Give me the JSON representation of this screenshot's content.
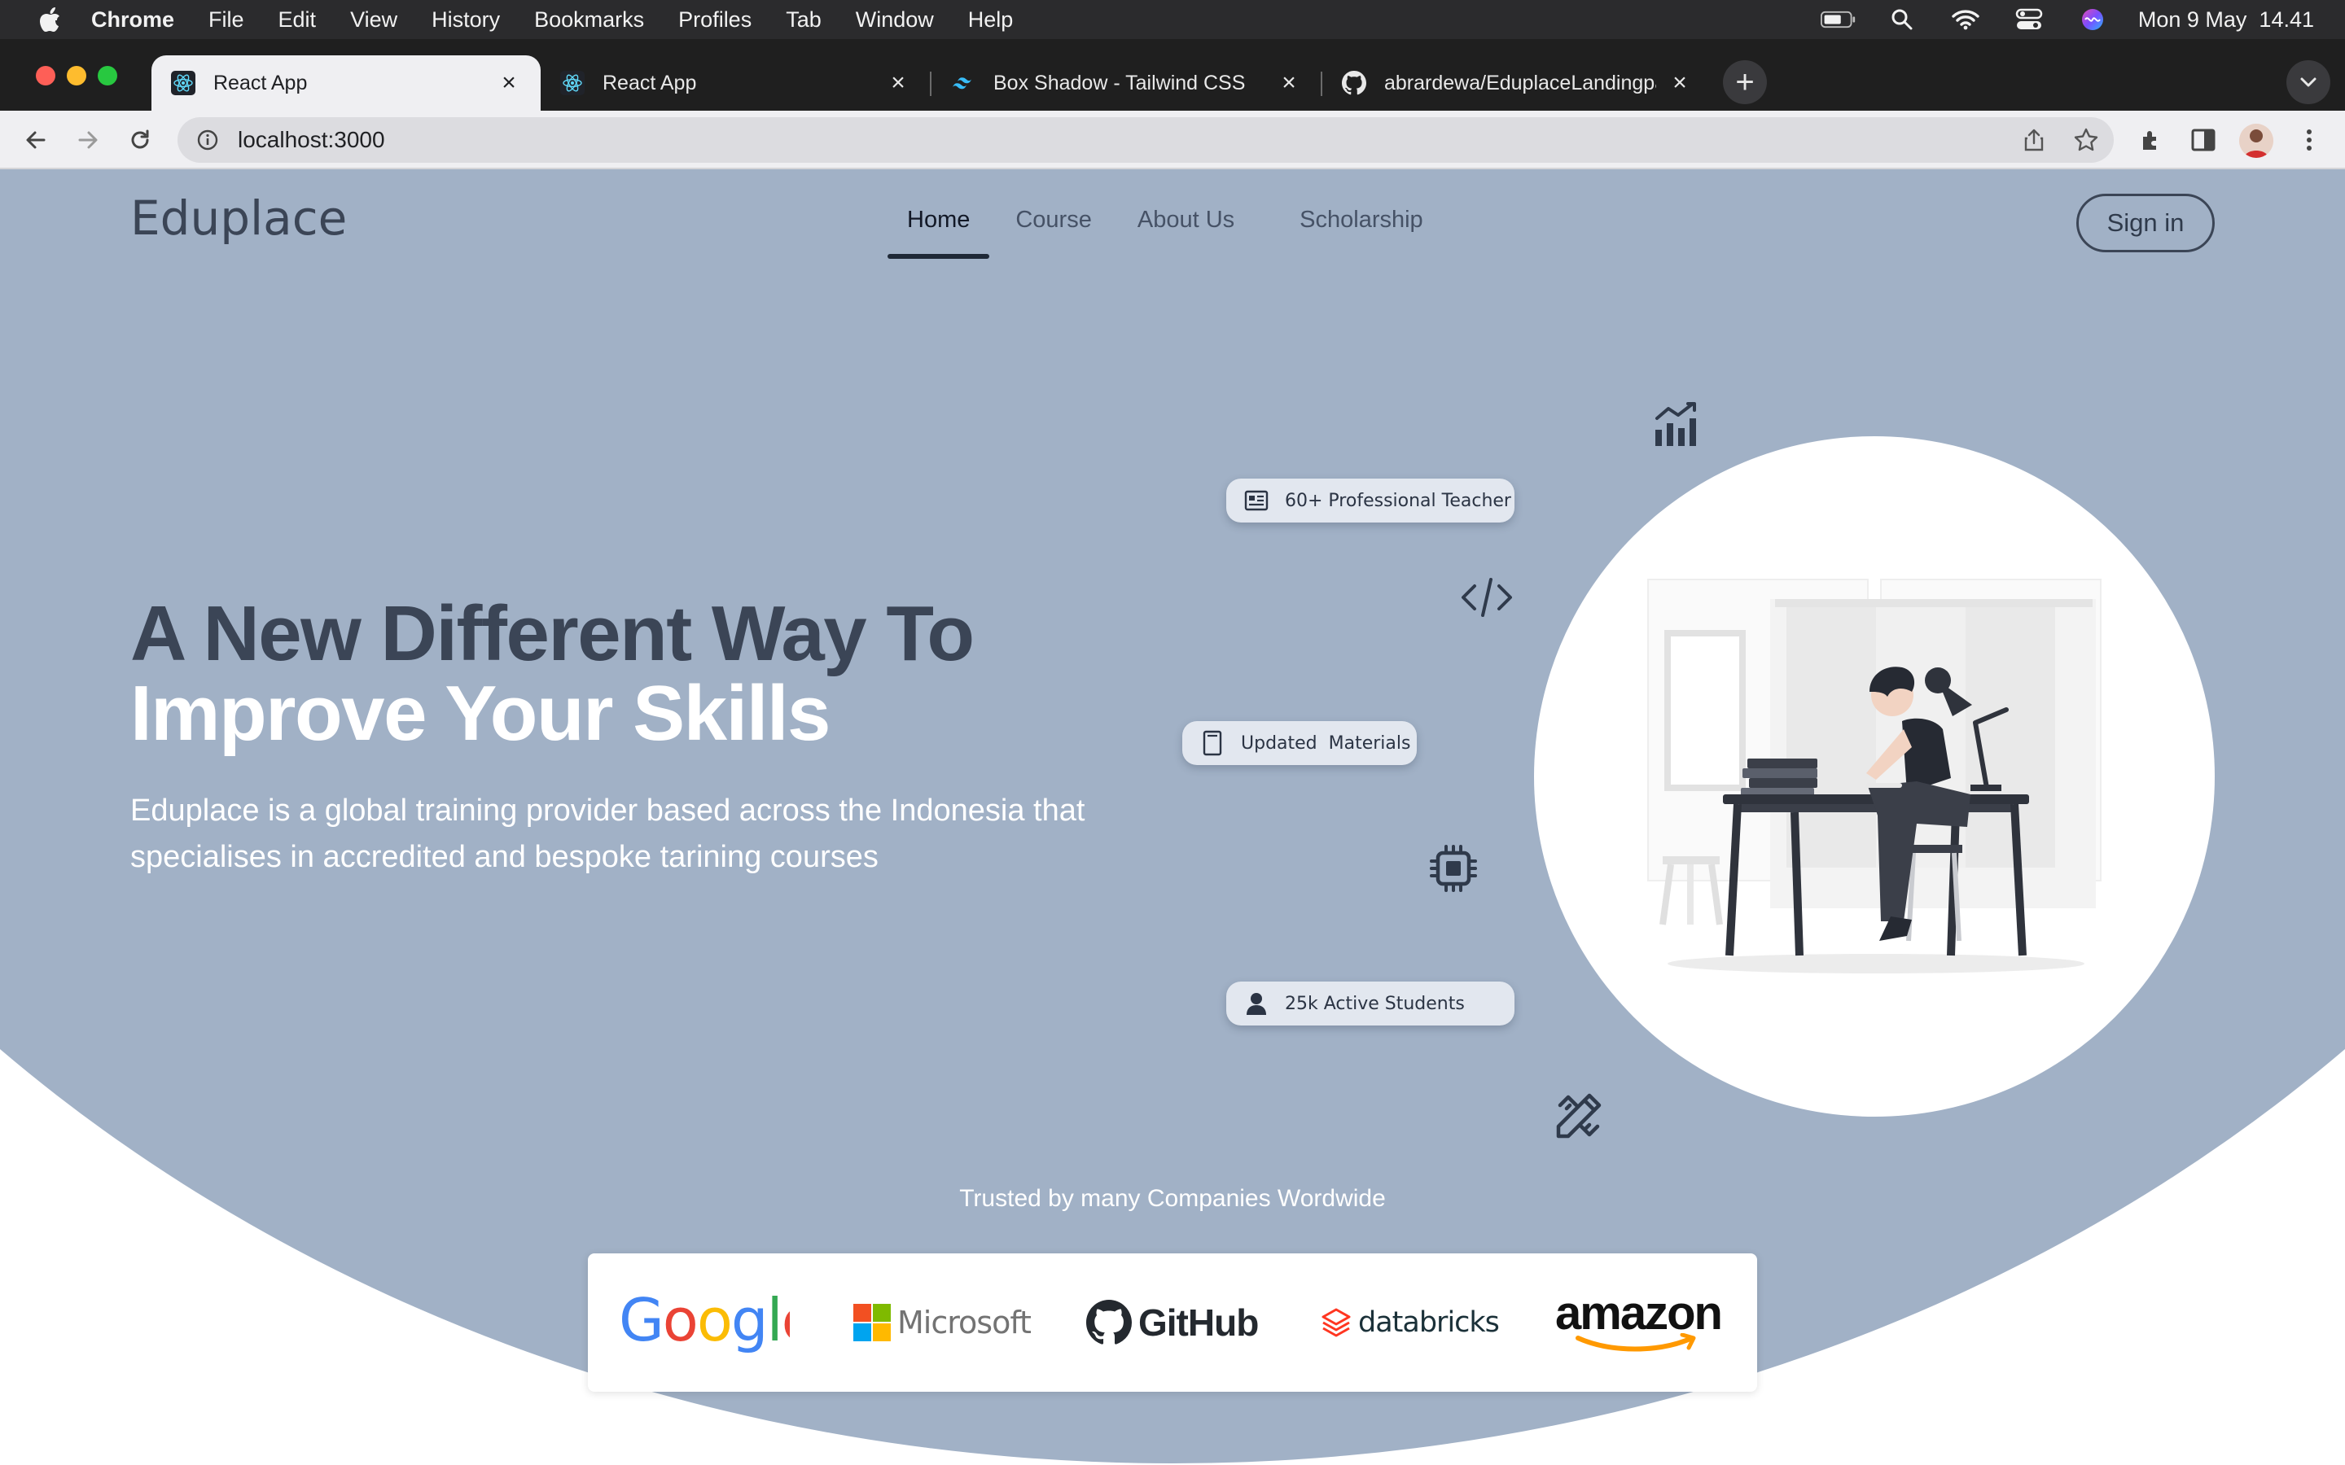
{
  "menubar": {
    "app_name": "Chrome",
    "items": [
      "File",
      "Edit",
      "View",
      "History",
      "Bookmarks",
      "Profiles",
      "Tab",
      "Window",
      "Help"
    ],
    "datetime": "Mon 9 May  14.41"
  },
  "tabs": [
    {
      "title": "React App",
      "favicon": "react-icon",
      "active": true
    },
    {
      "title": "React App",
      "favicon": "react-icon",
      "active": false
    },
    {
      "title": "Box Shadow - Tailwind CSS",
      "favicon": "tailwind-icon",
      "active": false
    },
    {
      "title": "abrardewa/EduplaceLandingpa",
      "favicon": "github-icon",
      "active": false
    }
  ],
  "toolbar": {
    "url": "localhost:3000"
  },
  "site": {
    "logo": "Eduplace",
    "nav": [
      "Home",
      "Course",
      "About Us",
      "Scholarship"
    ],
    "signin": "Sign in",
    "headline_line1": "A New Different Way To",
    "headline_line2": "Improve Your Skills",
    "subtitle": "Eduplace is a global training provider based across the Indonesia that specialises in accredited and bespoke tarining courses",
    "pills": {
      "teacher": "60+ Professional Teacher",
      "materials": "Updated  Materials",
      "students": "25k Active Students"
    },
    "trusted": "Trusted by many Companies Wordwide",
    "companies": {
      "google": "Google",
      "microsoft": "Microsoft",
      "github": "GitHub",
      "databricks": "databricks",
      "amazon": "amazon"
    }
  },
  "colors": {
    "hero_bg": "#a1b1c6",
    "heading_dark": "#3b4556",
    "pill_bg": "#e2e7ef"
  }
}
